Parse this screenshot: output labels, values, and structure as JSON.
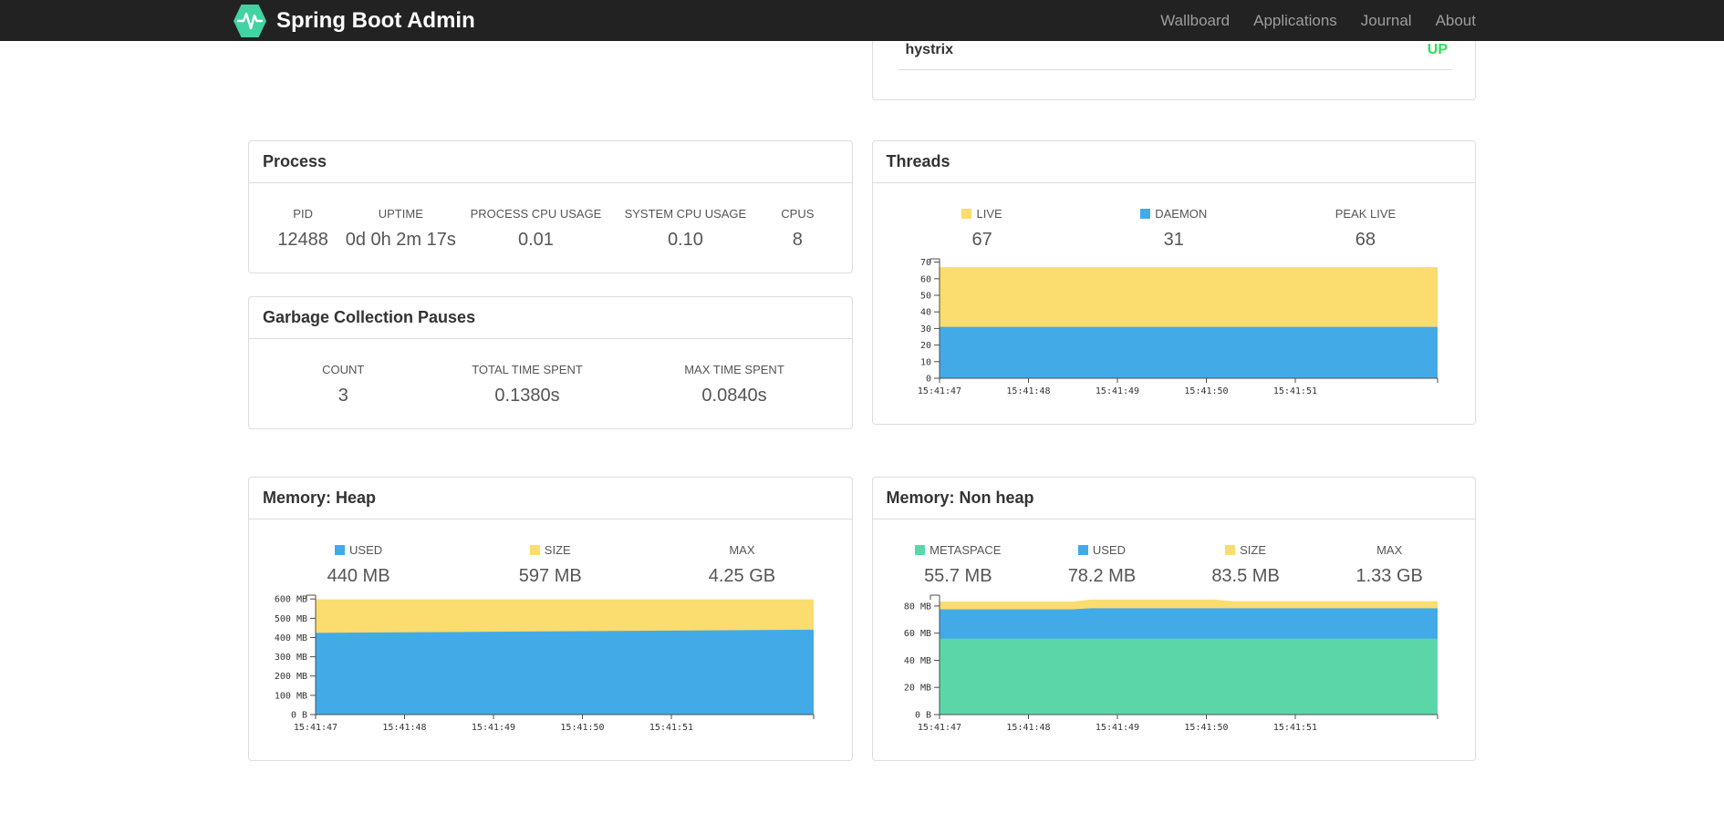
{
  "navbar": {
    "brand": "Spring Boot Admin",
    "brand_color": "#42d3a2",
    "items": [
      {
        "label": "Wallboard"
      },
      {
        "label": "Applications"
      },
      {
        "label": "Journal"
      },
      {
        "label": "About"
      }
    ]
  },
  "status_panel": {
    "name": "hystrix",
    "status": "UP",
    "status_color": "#30dd59"
  },
  "panels": {
    "process": {
      "title": "Process",
      "metrics": [
        {
          "label": "PID",
          "value": "12488"
        },
        {
          "label": "UPTIME",
          "value": "0d 0h 2m 17s"
        },
        {
          "label": "PROCESS CPU USAGE",
          "value": "0.01"
        },
        {
          "label": "SYSTEM CPU USAGE",
          "value": "0.10"
        },
        {
          "label": "CPUS",
          "value": "8"
        }
      ]
    },
    "gc": {
      "title": "Garbage Collection Pauses",
      "metrics": [
        {
          "label": "COUNT",
          "value": "3"
        },
        {
          "label": "TOTAL TIME SPENT",
          "value": "0.1380s"
        },
        {
          "label": "MAX TIME SPENT",
          "value": "0.0840s"
        }
      ]
    },
    "threads": {
      "title": "Threads",
      "metrics": [
        {
          "label": "LIVE",
          "value": "67",
          "swatch": "#fbdc6e"
        },
        {
          "label": "DAEMON",
          "value": "31",
          "swatch": "#43aae8"
        },
        {
          "label": "PEAK LIVE",
          "value": "68"
        }
      ]
    },
    "heap": {
      "title": "Memory: Heap",
      "metrics": [
        {
          "label": "USED",
          "value": "440 MB",
          "swatch": "#43aae8"
        },
        {
          "label": "SIZE",
          "value": "597 MB",
          "swatch": "#fbdc6e"
        },
        {
          "label": "MAX",
          "value": "4.25 GB"
        }
      ]
    },
    "nonheap": {
      "title": "Memory: Non heap",
      "metrics": [
        {
          "label": "METASPACE",
          "value": "55.7 MB",
          "swatch": "#5bd6a9"
        },
        {
          "label": "USED",
          "value": "78.2 MB",
          "swatch": "#43aae8"
        },
        {
          "label": "SIZE",
          "value": "83.5 MB",
          "swatch": "#fbdc6e"
        },
        {
          "label": "MAX",
          "value": "1.33 GB"
        }
      ]
    }
  },
  "chart_data": [
    {
      "type": "area",
      "name": "threads",
      "stacked": true,
      "xlim": [
        0,
        5.6
      ],
      "ylim": [
        0,
        72
      ],
      "xticks": [
        [
          0,
          "15:41:47"
        ],
        [
          1,
          "15:41:48"
        ],
        [
          2,
          "15:41:49"
        ],
        [
          3,
          "15:41:50"
        ],
        [
          4,
          "15:41:51"
        ]
      ],
      "yticks": [
        [
          0,
          "0"
        ],
        [
          10,
          "10"
        ],
        [
          20,
          "20"
        ],
        [
          30,
          "30"
        ],
        [
          40,
          "40"
        ],
        [
          50,
          "50"
        ],
        [
          60,
          "60"
        ],
        [
          70,
          "70"
        ]
      ],
      "series": [
        {
          "name": "DAEMON",
          "color": "#43aae8",
          "points": [
            [
              0,
              31
            ],
            [
              5.6,
              31
            ]
          ]
        },
        {
          "name": "LIVE",
          "color": "#fbdc6e",
          "points": [
            [
              0,
              67
            ],
            [
              5.6,
              67
            ]
          ]
        }
      ]
    },
    {
      "type": "area",
      "name": "memory-heap",
      "stacked": true,
      "xlim": [
        0,
        5.6
      ],
      "ylim": [
        0,
        620
      ],
      "xticks": [
        [
          0,
          "15:41:47"
        ],
        [
          1,
          "15:41:48"
        ],
        [
          2,
          "15:41:49"
        ],
        [
          3,
          "15:41:50"
        ],
        [
          4,
          "15:41:51"
        ]
      ],
      "yticks": [
        [
          0,
          "0 B"
        ],
        [
          100,
          "100 MB"
        ],
        [
          200,
          "200 MB"
        ],
        [
          300,
          "300 MB"
        ],
        [
          400,
          "400 MB"
        ],
        [
          500,
          "500 MB"
        ],
        [
          600,
          "600 MB"
        ]
      ],
      "series": [
        {
          "name": "USED",
          "color": "#43aae8",
          "points": [
            [
              0,
              424
            ],
            [
              1,
              427
            ],
            [
              2,
              430
            ],
            [
              3,
              433
            ],
            [
              4,
              436
            ],
            [
              5,
              439
            ],
            [
              5.6,
              441
            ]
          ]
        },
        {
          "name": "SIZE",
          "color": "#fbdc6e",
          "points": [
            [
              0,
              598
            ],
            [
              5.6,
              598
            ]
          ]
        }
      ]
    },
    {
      "type": "area",
      "name": "memory-nonheap",
      "stacked": true,
      "xlim": [
        0,
        5.6
      ],
      "ylim": [
        0,
        88
      ],
      "xticks": [
        [
          0,
          "15:41:47"
        ],
        [
          1,
          "15:41:48"
        ],
        [
          2,
          "15:41:49"
        ],
        [
          3,
          "15:41:50"
        ],
        [
          4,
          "15:41:51"
        ]
      ],
      "yticks": [
        [
          0,
          "0 B"
        ],
        [
          20,
          "20 MB"
        ],
        [
          40,
          "40 MB"
        ],
        [
          60,
          "60 MB"
        ],
        [
          80,
          "80 MB"
        ]
      ],
      "series": [
        {
          "name": "METASPACE",
          "color": "#5bd6a9",
          "points": [
            [
              0,
              55.9
            ],
            [
              5.6,
              55.9
            ]
          ]
        },
        {
          "name": "USED",
          "color": "#43aae8",
          "points": [
            [
              0,
              77.6
            ],
            [
              1.5,
              77.6
            ],
            [
              1.7,
              78.3
            ],
            [
              5.6,
              78.3
            ]
          ]
        },
        {
          "name": "SIZE",
          "color": "#fbdc6e",
          "points": [
            [
              0,
              83.3
            ],
            [
              1.5,
              83.3
            ],
            [
              1.7,
              84.7
            ],
            [
              3.1,
              84.7
            ],
            [
              3.3,
              83.6
            ],
            [
              5.6,
              83.6
            ]
          ]
        }
      ]
    }
  ]
}
